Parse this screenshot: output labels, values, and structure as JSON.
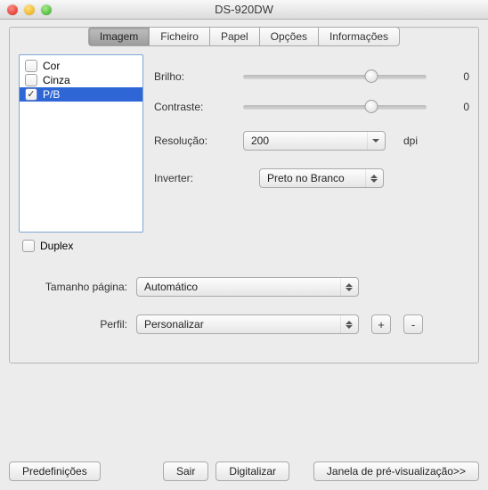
{
  "window": {
    "title": "DS-920DW"
  },
  "tabs": {
    "items": [
      {
        "label": "Imagem",
        "active": true
      },
      {
        "label": "Ficheiro",
        "active": false
      },
      {
        "label": "Papel",
        "active": false
      },
      {
        "label": "Opções",
        "active": false
      },
      {
        "label": "Informações",
        "active": false
      }
    ]
  },
  "image_modes": {
    "items": [
      {
        "label": "Cor",
        "checked": false,
        "selected": false
      },
      {
        "label": "Cinza",
        "checked": false,
        "selected": false
      },
      {
        "label": "P/B",
        "checked": true,
        "selected": true
      }
    ]
  },
  "controls": {
    "brightness": {
      "label": "Brilho:",
      "value": "0"
    },
    "contrast": {
      "label": "Contraste:",
      "value": "0"
    },
    "resolution": {
      "label": "Resolução:",
      "value": "200",
      "unit": "dpi"
    },
    "invert": {
      "label": "Inverter:",
      "value": "Preto no Branco"
    }
  },
  "duplex": {
    "label": "Duplex",
    "checked": false
  },
  "page_size": {
    "label": "Tamanho página:",
    "value": "Automático"
  },
  "profile": {
    "label": "Perfil:",
    "value": "Personalizar",
    "plus": "+",
    "minus": "-"
  },
  "footer": {
    "presets": "Predefinições",
    "exit": "Sair",
    "scan": "Digitalizar",
    "preview": "Janela de pré-visualização>>"
  }
}
